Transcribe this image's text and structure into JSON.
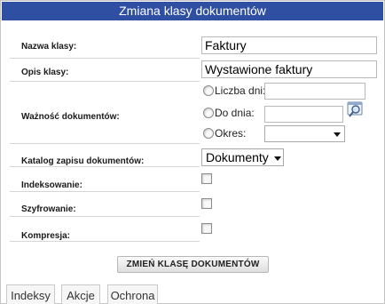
{
  "window": {
    "title": "Zmiana klasy dokumentów"
  },
  "form": {
    "class_name": {
      "label": "Nazwa klasy:",
      "value": "Faktury"
    },
    "class_desc": {
      "label": "Opis klasy:",
      "value": "Wystawione faktury"
    },
    "validity": {
      "label": "Ważność dokumentów:",
      "options": [
        {
          "label": "Liczba dni:",
          "selected": false
        },
        {
          "label": "Do dnia:",
          "selected": false
        },
        {
          "label": "Okres:",
          "selected": false
        }
      ]
    },
    "catalog": {
      "label": "Katalog zapisu dokumentów:",
      "value": "Dokumenty"
    },
    "indexing": {
      "label": "Indeksowanie:",
      "checked": false
    },
    "encryption": {
      "label": "Szyfrowanie:",
      "checked": false
    },
    "compression": {
      "label": "Kompresja:",
      "checked": false
    },
    "submit_label": "ZMIEŃ KLASĘ DOKUMENTÓW"
  },
  "tabs": [
    {
      "label": "Indeksy"
    },
    {
      "label": "Akcje"
    },
    {
      "label": "Ochrona"
    }
  ],
  "icons": {
    "calendar_picker": "magnifier-calendar-icon"
  }
}
